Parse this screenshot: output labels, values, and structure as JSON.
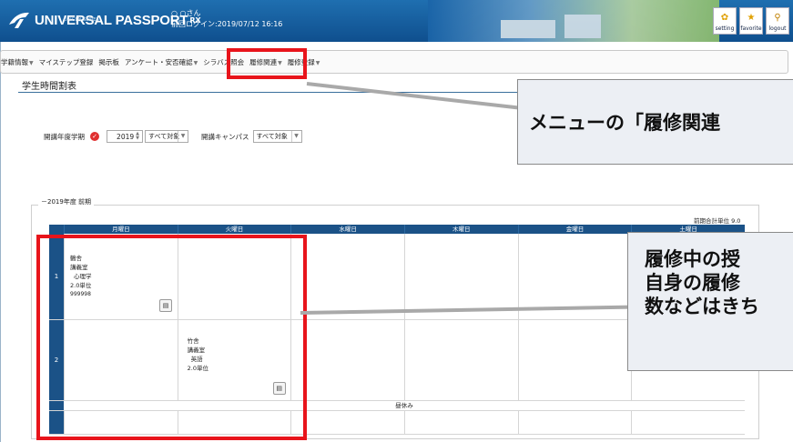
{
  "header": {
    "logo_text": "UNIVERSAL PASSPORT",
    "logo_sup": "RX",
    "logo_sub": "DAIGEN SERIES",
    "user_name": "○ ○さん",
    "last_login": "前回ログイン:2019/07/12 16:16",
    "buttons": [
      {
        "label": "setting",
        "icon": "gear-icon"
      },
      {
        "label": "favorite",
        "icon": "star-icon"
      },
      {
        "label": "logout",
        "icon": "logout-icon"
      }
    ]
  },
  "menu": {
    "items": [
      "学籍情報",
      "マイステップ登録",
      "掲示板",
      "アンケート・安否確認",
      "シラバス照会",
      "履修関連",
      "履修登録"
    ]
  },
  "page": {
    "title": "学生時間割表"
  },
  "filters": {
    "year_term_label": "開講年度学期",
    "year_value": "2019",
    "term_value": "すべて対象",
    "campus_label": "開講キャンパス",
    "campus_value": "すべて対象"
  },
  "timetable": {
    "legend": "2019年度 前期",
    "credits_label": "前期合計単位 9.0",
    "days": [
      "月曜日",
      "火曜日",
      "水曜日",
      "木曜日",
      "金曜日",
      "土曜日"
    ],
    "periods": [
      {
        "num": "1",
        "mon": {
          "room_prefix": "鶴舎",
          "room": "講義室",
          "subject": "心理学",
          "credits": "2.0単位",
          "code": "999998"
        }
      },
      {
        "num": "2",
        "tue": {
          "room_prefix": "竹舎",
          "room": "講義室",
          "subject": "英語",
          "credits": "2.0単位"
        }
      }
    ],
    "lunch": "昼休み"
  },
  "callouts": {
    "menu_note": "メニューの「履修関連",
    "course_note_line1": "履修中の授",
    "course_note_line2": "自身の履修",
    "course_note_line3": "数などはきち"
  },
  "colors": {
    "header": "#0f4f8e",
    "accent_red": "#e8141b",
    "grid_header": "#1b5287"
  }
}
